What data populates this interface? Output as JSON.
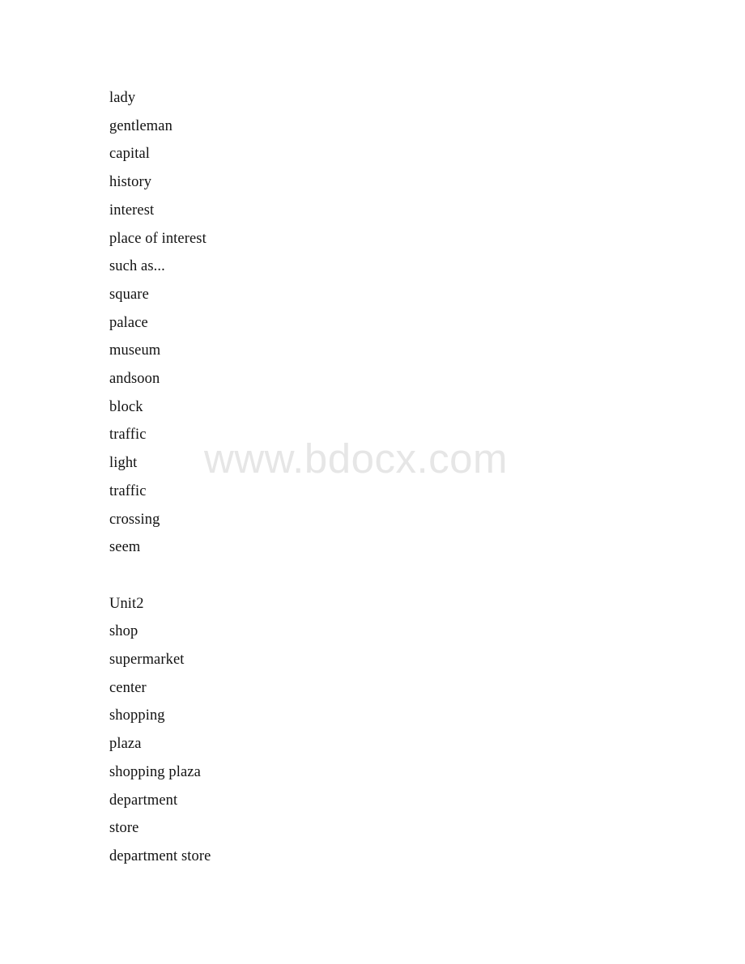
{
  "document": {
    "watermark": "www.bdocx.com",
    "lines": [
      {
        "text": "lady",
        "blank": false
      },
      {
        "text": "gentleman",
        "blank": false
      },
      {
        "text": "capital",
        "blank": false
      },
      {
        "text": "history",
        "blank": false
      },
      {
        "text": "interest",
        "blank": false
      },
      {
        "text": "place of interest",
        "blank": false
      },
      {
        "text": "such as...",
        "blank": false
      },
      {
        "text": "square",
        "blank": false
      },
      {
        "text": "palace",
        "blank": false
      },
      {
        "text": "museum",
        "blank": false
      },
      {
        "text": "andsoon",
        "blank": false
      },
      {
        "text": "block",
        "blank": false
      },
      {
        "text": "traffic",
        "blank": false
      },
      {
        "text": "light",
        "blank": false
      },
      {
        "text": "traffic",
        "blank": false
      },
      {
        "text": "crossing",
        "blank": false
      },
      {
        "text": "seem",
        "blank": false
      },
      {
        "text": " ",
        "blank": true
      },
      {
        "text": "Unit2",
        "blank": false
      },
      {
        "text": "shop",
        "blank": false
      },
      {
        "text": "supermarket",
        "blank": false
      },
      {
        "text": "center",
        "blank": false
      },
      {
        "text": "shopping",
        "blank": false
      },
      {
        "text": "plaza",
        "blank": false
      },
      {
        "text": "shopping plaza",
        "blank": false
      },
      {
        "text": "department",
        "blank": false
      },
      {
        "text": "store",
        "blank": false
      },
      {
        "text": "department store",
        "blank": false
      }
    ],
    "colors": {
      "page_background": "#ffffff",
      "body_text": "#121212",
      "watermark_text": "#e6e6e6"
    }
  }
}
